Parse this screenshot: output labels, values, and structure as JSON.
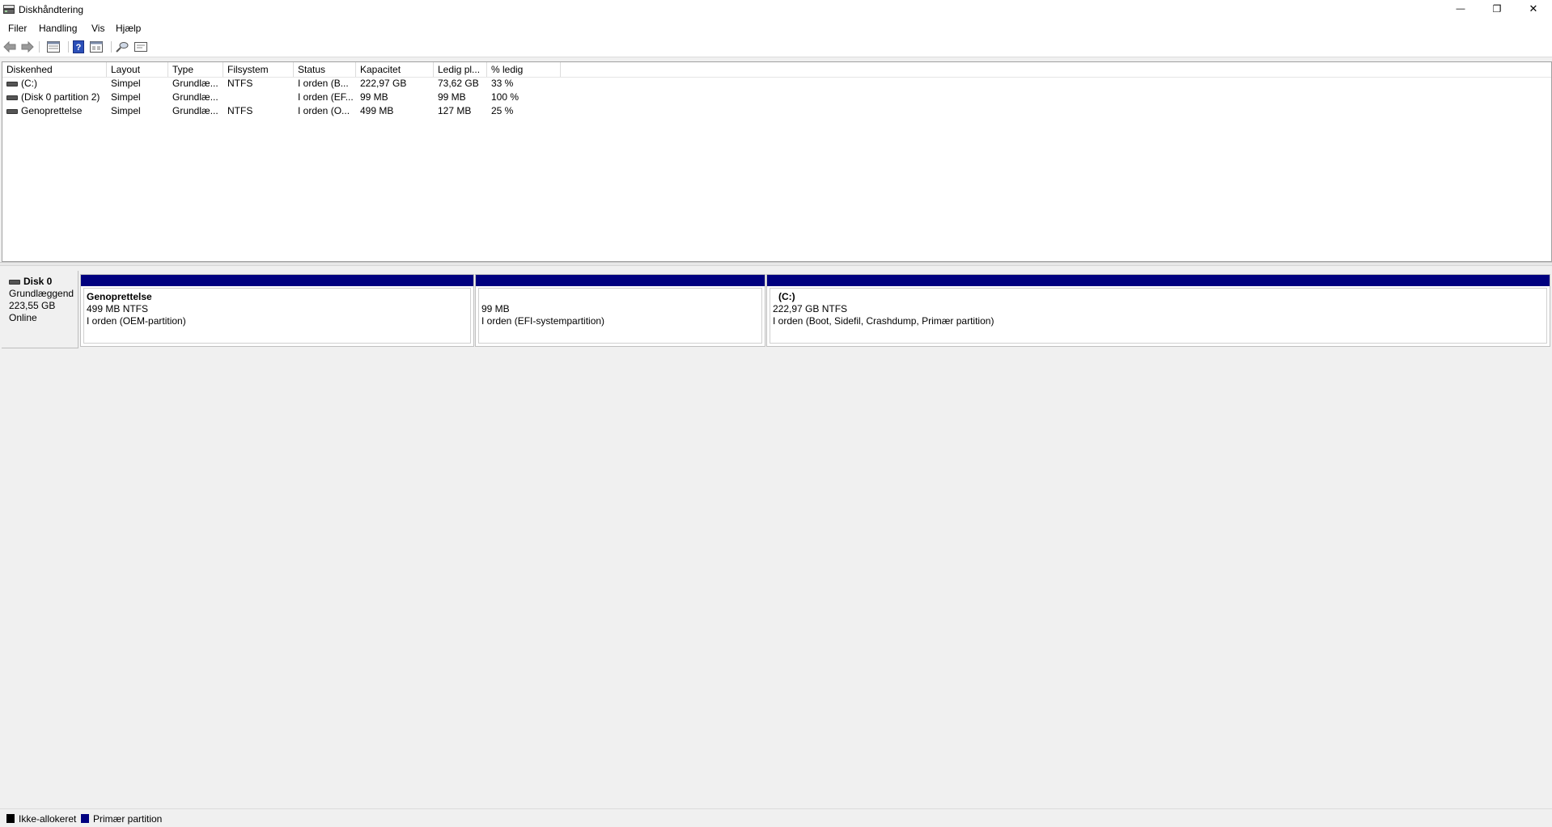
{
  "window": {
    "title": "Diskhåndtering",
    "minimize_glyph": "—",
    "maximize_glyph": "❐",
    "close_glyph": "✕"
  },
  "menu": [
    "Filer",
    "Handling",
    "Vis",
    "Hjælp"
  ],
  "toolbar": {
    "icons": [
      "back-arrow-icon",
      "forward-arrow-icon",
      "volume-list-icon",
      "help-icon",
      "properties-icon",
      "rescan-icon",
      "view-icon"
    ]
  },
  "volume_list": {
    "columns": [
      "Diskenhed",
      "Layout",
      "Type",
      "Filsystem",
      "Status",
      "Kapacitet",
      "Ledig pl...",
      "% ledig"
    ],
    "rows": [
      [
        "(C:)",
        "Simpel",
        "Grundlæ...",
        "NTFS",
        "I orden (B...",
        "222,97 GB",
        "73,62 GB",
        "33 %"
      ],
      [
        "(Disk 0 partition 2)",
        "Simpel",
        "Grundlæ...",
        "",
        "I orden (EF...",
        "99 MB",
        "99 MB",
        "100 %"
      ],
      [
        "Genoprettelse",
        "Simpel",
        "Grundlæ...",
        "NTFS",
        "I orden (O...",
        "499 MB",
        "127 MB",
        "25 %"
      ]
    ]
  },
  "disk": {
    "name": "Disk 0",
    "type": "Grundlæggend",
    "size": "223,55 GB",
    "status": "Online",
    "partitions": [
      {
        "name": "Genoprettelse",
        "size": "499 MB NTFS",
        "status": "I orden (OEM-partition)"
      },
      {
        "name": "",
        "size": "99 MB",
        "status": "I orden (EFI-systempartition)"
      },
      {
        "name": "(C:)",
        "size": "222,97 GB NTFS",
        "status": "I orden (Boot, Sidefil, Crashdump, Primær partition)"
      }
    ]
  },
  "legend": [
    {
      "label": "Ikke-allokeret",
      "color": "#000000"
    },
    {
      "label": "Primær partition",
      "color": "#00007f"
    }
  ]
}
